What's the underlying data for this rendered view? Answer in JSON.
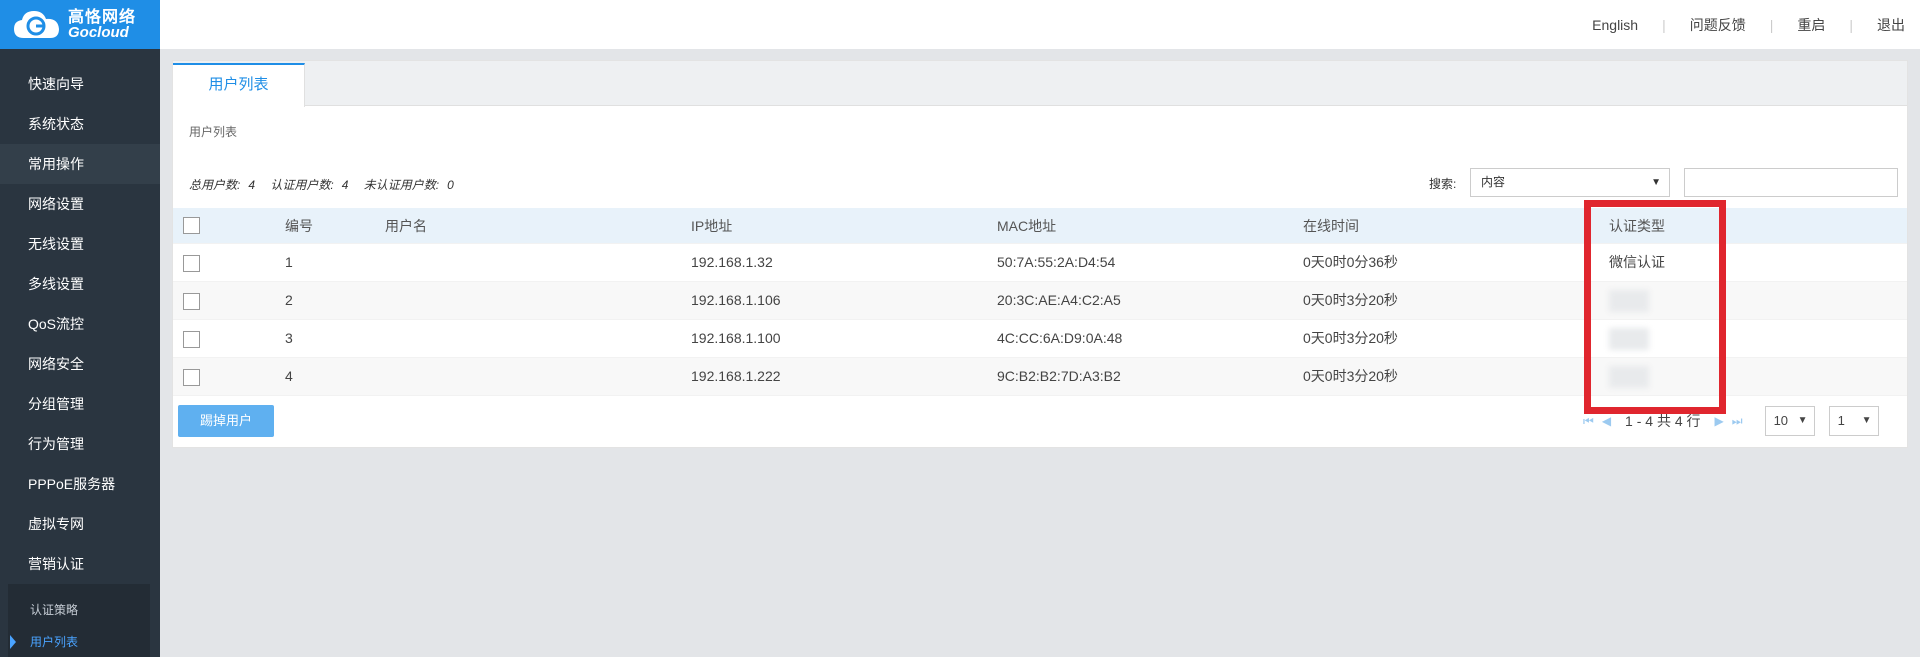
{
  "logo": {
    "cn": "高恪网络",
    "en": "Gocloud"
  },
  "sidebar": {
    "items": [
      {
        "label": "快速向导"
      },
      {
        "label": "系统状态"
      },
      {
        "label": "常用操作"
      },
      {
        "label": "网络设置"
      },
      {
        "label": "无线设置"
      },
      {
        "label": "多线设置"
      },
      {
        "label": "QoS流控"
      },
      {
        "label": "网络安全"
      },
      {
        "label": "分组管理"
      },
      {
        "label": "行为管理"
      },
      {
        "label": "PPPoE服务器"
      },
      {
        "label": "虚拟专网"
      },
      {
        "label": "营销认证"
      }
    ],
    "active_index": 2,
    "submenu": [
      {
        "label": "认证策略"
      },
      {
        "label": "用户列表"
      }
    ]
  },
  "topbar": {
    "english": "English",
    "feedback": "问题反馈",
    "restart": "重启",
    "logout": "退出"
  },
  "tab": {
    "label": "用户列表"
  },
  "section_title": "用户列表",
  "stats": {
    "total_label": "总用户数:",
    "total": "4",
    "auth_label": "认证用户数:",
    "auth": "4",
    "unauth_label": "未认证用户数:",
    "unauth": "0"
  },
  "search": {
    "label": "搜索:",
    "select_value": "内容",
    "input_value": ""
  },
  "table": {
    "headers": {
      "id": "编号",
      "user": "用户名",
      "ip": "IP地址",
      "mac": "MAC地址",
      "time": "在线时间",
      "auth": "认证类型"
    },
    "rows": [
      {
        "id": "1",
        "user": "",
        "ip": "192.168.1.32",
        "mac": "50:7A:55:2A:D4:54",
        "time": "0天0时0分36秒",
        "auth": "微信认证"
      },
      {
        "id": "2",
        "user": "",
        "ip": "192.168.1.106",
        "mac": "20:3C:AE:A4:C2:A5",
        "time": "0天0时3分20秒",
        "auth": ""
      },
      {
        "id": "3",
        "user": "",
        "ip": "192.168.1.100",
        "mac": "4C:CC:6A:D9:0A:48",
        "time": "0天0时3分20秒",
        "auth": ""
      },
      {
        "id": "4",
        "user": "",
        "ip": "192.168.1.222",
        "mac": "9C:B2:B2:7D:A3:B2",
        "time": "0天0时3分20秒",
        "auth": ""
      }
    ]
  },
  "kick_button": "踢掉用户",
  "pager": {
    "info": "1 - 4 共 4 行",
    "page_size": "10",
    "page": "1"
  },
  "colors": {
    "accent": "#1f8ee6",
    "sidebar_bg": "#2a3540",
    "highlight": "#e0262e"
  }
}
